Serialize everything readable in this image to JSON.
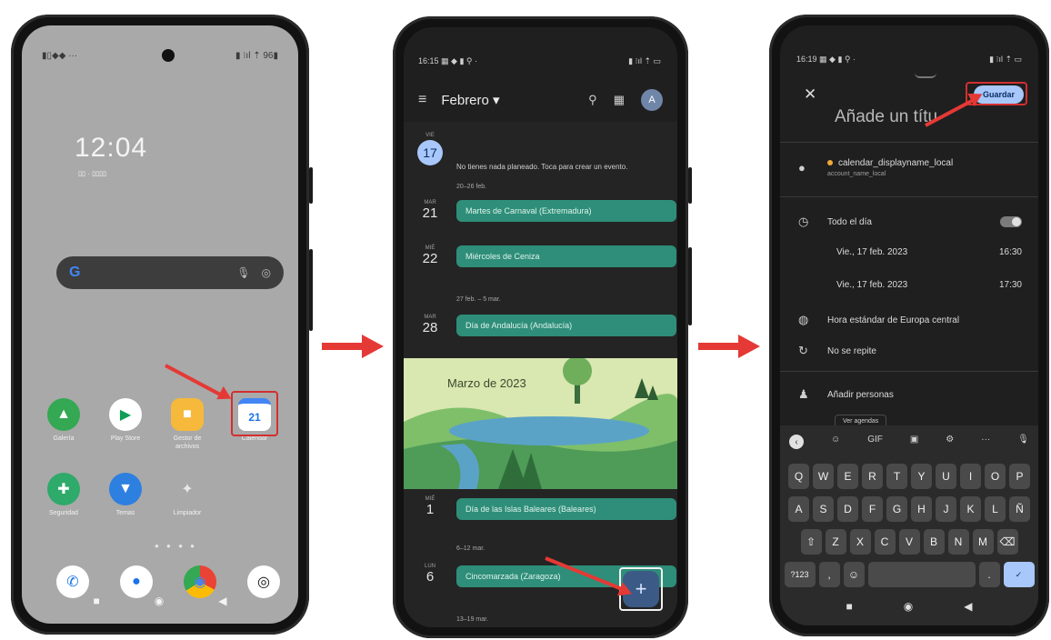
{
  "phone1": {
    "clock": "12:04",
    "clock_sub": "ﾛﾛ · ﾛﾛﾛﾛ",
    "status_left": "▮▯◆◆ ···",
    "status_right": "▮ ⁝ıl ⇡ 96▮",
    "search_google": "G",
    "search_mic": "🎙",
    "search_lens": "◎",
    "apps": [
      {
        "label": "Galería",
        "color": "#34a853",
        "glyph": "▲"
      },
      {
        "label": "Play Store",
        "color": "#ffffff",
        "glyph": "▶"
      },
      {
        "label": "Gestor de archivos",
        "color": "#f6b93b",
        "glyph": "■"
      },
      {
        "label": "Calendar",
        "color": "#ffffff",
        "glyph": "21"
      },
      {
        "label": "Seguridad",
        "color": "#2eaa6a",
        "glyph": "✚"
      },
      {
        "label": "Temas",
        "color": "#2d7fe0",
        "glyph": "▼"
      },
      {
        "label": "Limpiador",
        "color": "#bdbdbd",
        "glyph": "✦"
      }
    ],
    "dock": [
      {
        "glyph": "✆",
        "color": "#ffffff"
      },
      {
        "glyph": "●",
        "color": "#ffffff"
      },
      {
        "glyph": "◉",
        "color": "#ffffff"
      },
      {
        "glyph": "◎",
        "color": "#ffffff"
      }
    ],
    "page_dots": "● ● ● ●",
    "nav": [
      "■",
      "◉",
      "◀"
    ]
  },
  "phone2": {
    "status_left": "16:15 ▦ ◆ ▮ ⚲ ·",
    "status_right": "▮ ⁝ıl ⇡ ▭",
    "menu_icon": "≡",
    "month": "Febrero ▾",
    "search_icon": "⚲",
    "today_icon": "▦",
    "avatar": "A",
    "today_dw": "VIE",
    "today_dn": "17",
    "no_plans": "No tienes nada planeado. Toca para crear un evento.",
    "range1": "20–26 feb.",
    "mar_dw": "MAR",
    "mar_dn": "21",
    "ev1": "Martes de Carnaval (Extremadura)",
    "mie_dw": "MIÉ",
    "mie_dn": "22",
    "ev2": "Miércoles de Ceniza",
    "range2": "27 feb. – 5 mar.",
    "mar2_dw": "MAR",
    "mar2_dn": "28",
    "ev3": "Día de Andalucía (Andalucía)",
    "banner_title": "Marzo de 2023",
    "mie2_dw": "MIÉ",
    "mie2_dn": "1",
    "ev4": "Día de las Islas Baleares (Baleares)",
    "range3": "6–12 mar.",
    "lun_dw": "LUN",
    "lun_dn": "6",
    "ev5": "Cincomarzada (Zaragoza)",
    "range4": "13–19 mar.",
    "fab": "+"
  },
  "phone3": {
    "status_left": "16:19 ▦ ◆ ▮ ⚲ ·",
    "status_right": "▮ ⁝ıl ⇡ ▭",
    "close": "✕",
    "save": "Guardar",
    "title_placeholder": "Añade un títu",
    "calendar_name": "calendar_displayname_local",
    "account_name": "account_name_local",
    "all_day": "Todo el día",
    "start_date": "Vie., 17 feb. 2023",
    "start_time": "16:30",
    "end_date": "Vie., 17 feb. 2023",
    "end_time": "17:30",
    "timezone": "Hora estándar de Europa central",
    "repeat": "No se repite",
    "people": "Añadir personas",
    "chip": "Ver agendas",
    "kb_tools": [
      "‹",
      "☺",
      "GIF",
      "▣",
      "⚙",
      "···",
      "🎙"
    ],
    "row1": [
      "Q",
      "W",
      "E",
      "R",
      "T",
      "Y",
      "U",
      "I",
      "O",
      "P"
    ],
    "row2": [
      "A",
      "S",
      "D",
      "F",
      "G",
      "H",
      "J",
      "K",
      "L",
      "Ñ"
    ],
    "row3": [
      "⇧",
      "Z",
      "X",
      "C",
      "V",
      "B",
      "N",
      "M",
      "⌫"
    ],
    "row4_left": "?123",
    "row4_emoji": "☺",
    "row4_comma": ",",
    "row4_dot": ".",
    "row4_action": "✓",
    "nav": [
      "■",
      "◉",
      "◀"
    ]
  }
}
